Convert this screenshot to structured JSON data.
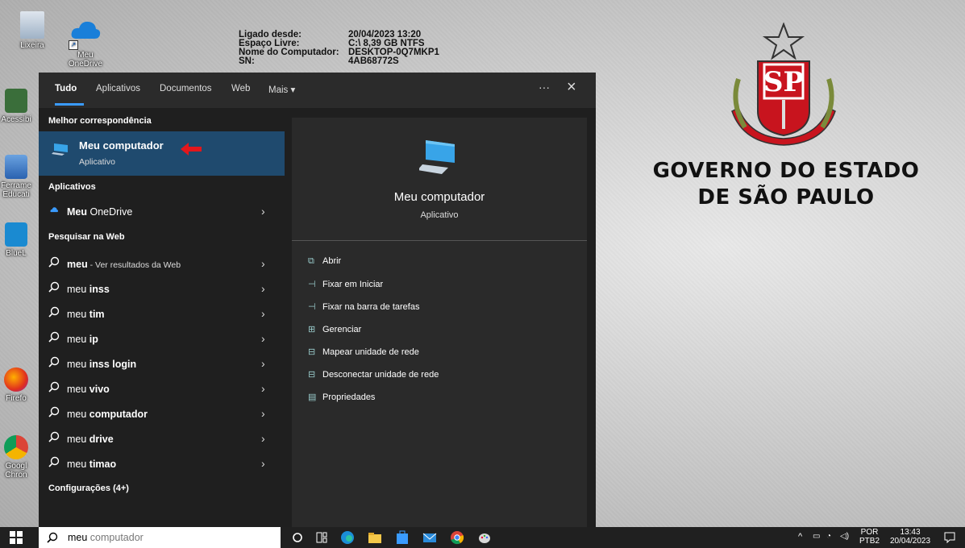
{
  "desktop": {
    "icons": [
      {
        "label": "Lixeira"
      },
      {
        "label": "Meu\nOneDrive"
      },
      {
        "label": "Acessibi"
      },
      {
        "label": "Ferrame\nEducati"
      },
      {
        "label": "BlueL"
      },
      {
        "label": "Firefo"
      },
      {
        "label": "Googl\nChron"
      }
    ],
    "bginfo": [
      {
        "k": "Ligado desde:",
        "v": "20/04/2023 13:20"
      },
      {
        "k": "Espaço Livre:",
        "v": "C:\\ 8,39 GB NTFS"
      },
      {
        "k": "Nome do Computador:",
        "v": "DESKTOP-0Q7MKP1"
      },
      {
        "k": "SN:",
        "v": "4AB68772S"
      }
    ],
    "brand_line1": "GOVERNO DO ESTADO",
    "brand_line2": "DE SÃO PAULO",
    "seal_text": "SP",
    "seal_motto": "PRO BRASILIA FIANT EXIMIA"
  },
  "panel": {
    "tabs": [
      "Tudo",
      "Aplicativos",
      "Documentos",
      "Web",
      "Mais"
    ],
    "more_icon": "···",
    "close_icon": "×",
    "sections": {
      "best": "Melhor correspondência",
      "apps": "Aplicativos",
      "web": "Pesquisar na Web",
      "settings": "Configurações (4+)"
    },
    "best_match": {
      "title": "Meu computador",
      "subtitle": "Aplicativo"
    },
    "apps": [
      {
        "bold": "Meu",
        "rest": " OneDrive"
      }
    ],
    "web_results": [
      {
        "plain": "meu",
        "bold": "",
        "suffix": " - Ver resultados da Web"
      },
      {
        "plain": "meu ",
        "bold": "inss",
        "suffix": ""
      },
      {
        "plain": "meu ",
        "bold": "tim",
        "suffix": ""
      },
      {
        "plain": "meu ",
        "bold": "ip",
        "suffix": ""
      },
      {
        "plain": "meu ",
        "bold": "inss login",
        "suffix": ""
      },
      {
        "plain": "meu ",
        "bold": "vivo",
        "suffix": ""
      },
      {
        "plain": "meu ",
        "bold": "computador",
        "suffix": ""
      },
      {
        "plain": "meu ",
        "bold": "drive",
        "suffix": ""
      },
      {
        "plain": "meu ",
        "bold": "timao",
        "suffix": ""
      }
    ],
    "preview": {
      "title": "Meu computador",
      "subtitle": "Aplicativo",
      "actions": [
        "Abrir",
        "Fixar em Iniciar",
        "Fixar na barra de tarefas",
        "Gerenciar",
        "Mapear unidade de rede",
        "Desconectar unidade de rede",
        "Propriedades"
      ]
    }
  },
  "taskbar": {
    "search_typed": "meu",
    "search_suggest": " computador",
    "lang_top": "POR",
    "lang_bottom": "PTB2",
    "time": "13:43",
    "date": "20/04/2023"
  },
  "colors": {
    "accent": "#3a9bff",
    "selected": "#1f4a6e",
    "panel": "#1f1f1f"
  }
}
